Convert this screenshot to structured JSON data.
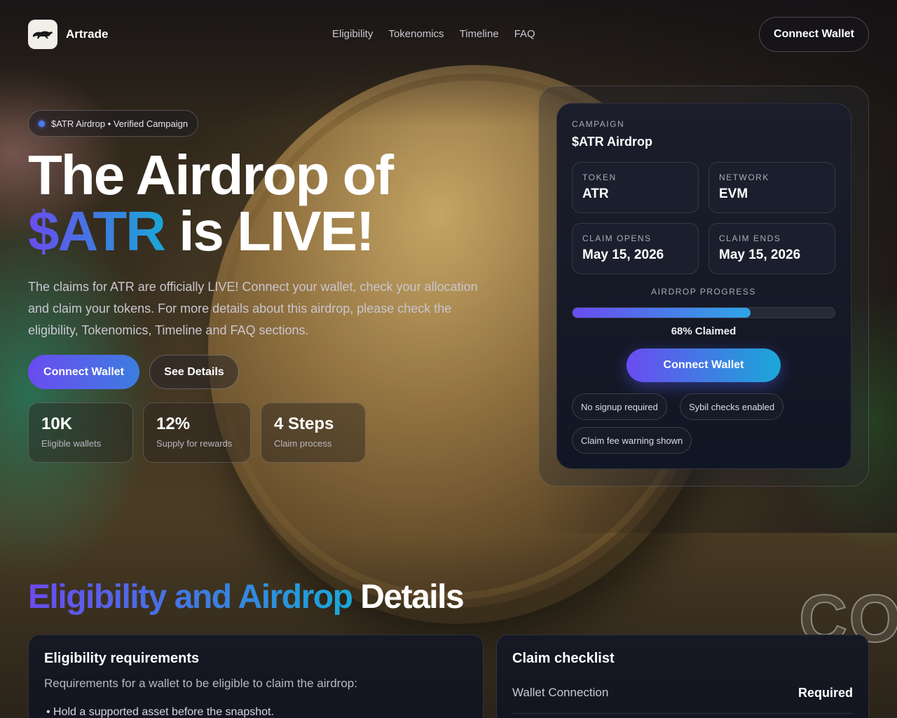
{
  "brand": {
    "name": "Artrade",
    "logo_icon": "panther-icon"
  },
  "nav": {
    "items": [
      "Eligibility",
      "Tokenomics",
      "Timeline",
      "FAQ"
    ]
  },
  "header": {
    "cta_label": "Connect Wallet"
  },
  "hero": {
    "badge": "$ATR Airdrop • Verified Campaign",
    "title_line1": "The Airdrop of",
    "title_highlight": "$ATR",
    "title_rest": " is LIVE!",
    "description": "The claims for ATR are officially LIVE! Connect your wallet, check your allocation and claim your tokens. For more details about this airdrop, please check the eligibility, Tokenomics, Timeline and FAQ sections.",
    "primary_cta": "Connect Wallet",
    "secondary_cta": "See Details",
    "stats": [
      {
        "value": "10K",
        "label": "Eligible wallets"
      },
      {
        "value": "12%",
        "label": "Supply for rewards"
      },
      {
        "value": "4 Steps",
        "label": "Claim process"
      }
    ]
  },
  "campaign_card": {
    "eyebrow": "CAMPAIGN",
    "title": "$ATR Airdrop",
    "token_label": "TOKEN",
    "token_value": "ATR",
    "network_label": "NETWORK",
    "network_value": "EVM",
    "claim_opens_label": "CLAIM OPENS",
    "claim_opens_value": "May 15, 2026",
    "claim_ends_label": "CLAIM ENDS",
    "claim_ends_value": "May 15, 2026",
    "progress_label": "AIRDROP PROGRESS",
    "progress_fraction": 0.68,
    "progress_text": "68% Claimed",
    "cta_label": "Connect Wallet",
    "pills": [
      "No signup required",
      "Sybil checks enabled",
      "Claim fee warning shown"
    ]
  },
  "section": {
    "title_highlight": "Eligibility and Airdrop",
    "title_rest": " Details",
    "watermark": "CO"
  },
  "eligibility_panel": {
    "title": "Eligibility requirements",
    "subtitle": "Requirements for a wallet to be eligible to claim the airdrop:",
    "first_bullet": "Hold a supported asset before the snapshot."
  },
  "checklist_panel": {
    "title": "Claim checklist",
    "row_label": "Wallet Connection",
    "row_value": "Required"
  },
  "colors": {
    "accent_start": "#6a4cf0",
    "accent_mid": "#3d7de0",
    "accent_end": "#1aa8d8",
    "card_bg": "#111624"
  }
}
